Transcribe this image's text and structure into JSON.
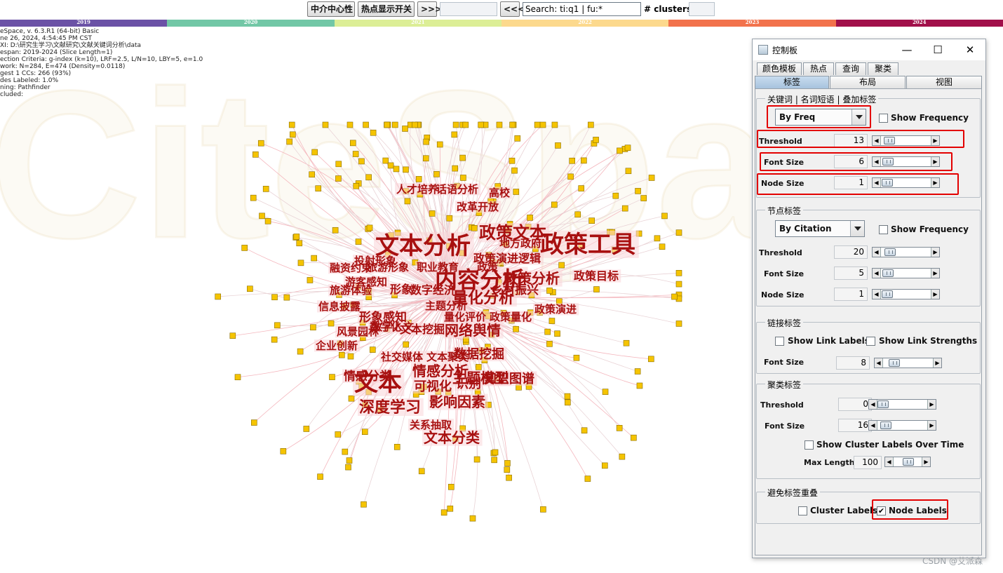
{
  "toolbar": {
    "centrality_btn": "中介中心性",
    "hotspot_btn": "热点显示开关",
    "next_btn": ">>>",
    "prev_btn": "<<<",
    "search_value": "Search: ti:q1 | fu:*",
    "clusters_label": "# clusters"
  },
  "timeline": {
    "years": [
      "2019",
      "2020",
      "2021",
      "2022",
      "2023",
      "2024"
    ],
    "colors": [
      "#6b52a6",
      "#72c7a6",
      "#dcee96",
      "#fcd98d",
      "#f2724c",
      "#a1104a"
    ]
  },
  "info_lines": [
    "eSpace, v. 6.3.R1 (64-bit) Basic",
    "ne 26, 2024, 4:54:45 PM CST",
    "XI: D:\\研究生学习\\文献研究\\文献关键词分析\\data",
    "espan: 2019-2024 (Slice Length=1)",
    "ection Criteria: g-index (k=10), LRF=2.5, L/N=10, LBY=5, e=1.0",
    "work: N=284, E=474 (Density=0.0118)",
    "gest 1 CCs: 266 (93%)",
    "des Labeled: 1.0%",
    "ning: Pathfinder",
    "cluded:"
  ],
  "watermark_text": "CiteSpace",
  "network": {
    "node_color": "#f5c400",
    "keywords": [
      "文本分析",
      "政策文本",
      "政策工具",
      "内容分析",
      "政策分析",
      "量化分析",
      "人才培养",
      "话语分析",
      "高校",
      "改革开放",
      "地方政府",
      "投射形象",
      "政策演进逻辑",
      "融资约束",
      "旅游形象",
      "职业教育",
      "政策",
      "政策目标",
      "游客感知",
      "乡村振兴",
      "旅游体验",
      "形象",
      "数字经济",
      "信息披露",
      "主题分析",
      "政策演进",
      "形象感知",
      "量化评价",
      "政策量化",
      "数字化",
      "文本挖掘",
      "网络舆情",
      "风景园林",
      "数字人文",
      "企业创新",
      "社交媒体",
      "文本聚类",
      "数据挖掘",
      "情感分析",
      "情感分类",
      "文本",
      "主题模型",
      "可视化",
      "识别",
      "知识图谱",
      "深度学习",
      "影响因素",
      "关系抽取",
      "文本分类"
    ]
  },
  "panel": {
    "title": "控制板",
    "tabs_row1": [
      "颜色模板",
      "热点",
      "查询",
      "聚类"
    ],
    "tabs_row2": [
      "标签",
      "布局",
      "视图"
    ],
    "keyword_labels": {
      "title": "关键词 | 名词短语 | 叠加标签",
      "sort": "By Freq",
      "show_frequency": "Show Frequency",
      "threshold_label": "Threshold",
      "threshold": "13",
      "font_size_label": "Font Size",
      "font_size": "6",
      "node_size_label": "Node Size",
      "node_size": "1"
    },
    "node_labels": {
      "title": "节点标签",
      "sort": "By Citation",
      "show_frequency": "Show Frequency",
      "threshold_label": "Threshold",
      "threshold": "20",
      "font_size_label": "Font Size",
      "font_size": "5",
      "node_size_label": "Node Size",
      "node_size": "1"
    },
    "link_labels": {
      "title": "链接标签",
      "show_link_labels": "Show Link Labels",
      "show_link_strengths": "Show Link Strengths",
      "font_size_label": "Font Size",
      "font_size": "8"
    },
    "cluster_labels": {
      "title": "聚类标签",
      "threshold_label": "Threshold",
      "threshold": "0",
      "font_size_label": "Font Size",
      "font_size": "16",
      "show_over_time": "Show Cluster Labels Over Time",
      "max_length_label": "Max Length",
      "max_length": "100"
    },
    "avoid_overlap": {
      "title": "避免标签重叠",
      "cluster_labels": "Cluster Labels",
      "node_labels": "Node Labels",
      "node_labels_check": "✔"
    }
  },
  "csdn_watermark": "CSDN @艾派森"
}
